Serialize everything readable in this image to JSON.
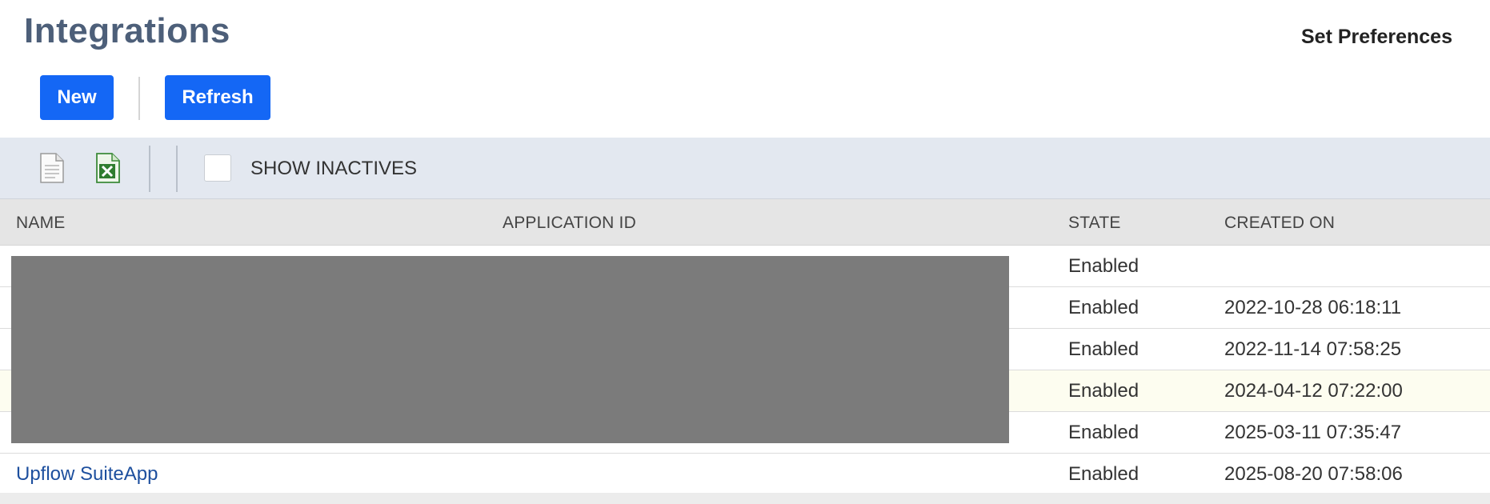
{
  "header": {
    "title": "Integrations",
    "set_preferences": "Set Preferences"
  },
  "actions": {
    "new_label": "New",
    "refresh_label": "Refresh"
  },
  "toolbar": {
    "export_csv_icon": "document-icon",
    "export_excel_icon": "excel-icon",
    "show_inactives_label": "SHOW INACTIVES",
    "show_inactives_checked": false
  },
  "table": {
    "columns": [
      "NAME",
      "APPLICATION ID",
      "STATE",
      "CREATED ON"
    ],
    "rows": [
      {
        "name": "",
        "app_id": "",
        "state": "Enabled",
        "created": ""
      },
      {
        "name": "",
        "app_id": "",
        "state": "Enabled",
        "created": "2022-10-28 06:18:11"
      },
      {
        "name": "",
        "app_id": "",
        "state": "Enabled",
        "created": "2022-11-14 07:58:25"
      },
      {
        "name": "",
        "app_id": "",
        "state": "Enabled",
        "created": "2024-04-12 07:22:00"
      },
      {
        "name": "",
        "app_id": "",
        "state": "Enabled",
        "created": "2025-03-11 07:35:47"
      },
      {
        "name": "Upflow SuiteApp",
        "app_id": "",
        "state": "Enabled",
        "created": "2025-08-20 07:58:06"
      }
    ]
  },
  "colors": {
    "accent": "#1467f5",
    "title": "#4d5f79",
    "link": "#1d4f9e",
    "toolbar_bg": "#e3e8f0",
    "redaction": "#7b7b7b"
  }
}
